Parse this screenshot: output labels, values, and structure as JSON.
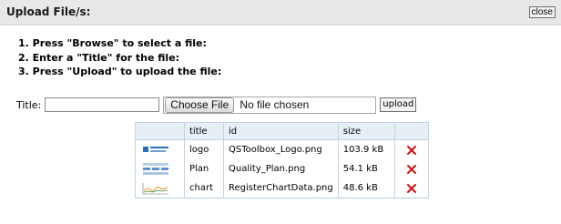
{
  "dialog": {
    "title": "Upload File/s:",
    "close_label": "close"
  },
  "instructions": [
    "1. Press \"Browse\" to select a file:",
    "2. Enter a \"Title\" for the file:",
    "3. Press \"Upload\" to upload the file:"
  ],
  "form": {
    "title_label": "Title:",
    "title_value": "",
    "choose_file_label": "Choose File",
    "file_status": "No file chosen",
    "upload_label": "upload"
  },
  "table": {
    "headers": [
      "",
      "title",
      "id",
      "size",
      ""
    ],
    "rows": [
      {
        "title": "logo",
        "id": "QSToolbox_Logo.png",
        "size": "103.9 kB",
        "thumb": "logo-thumbnail",
        "delete_icon": "red-x-icon"
      },
      {
        "title": "Plan",
        "id": "Quality_Plan.png",
        "size": "54.1 kB",
        "thumb": "diagram-thumbnail",
        "delete_icon": "red-x-icon"
      },
      {
        "title": "chart",
        "id": "RegisterChartData.png",
        "size": "48.6 kB",
        "thumb": "chart-thumbnail",
        "delete_icon": "red-x-icon"
      }
    ]
  },
  "colors": {
    "titlebar_bg": "#e8e8e8",
    "table_header_bg": "#e6eef6",
    "delete_icon": "#cc1111"
  }
}
